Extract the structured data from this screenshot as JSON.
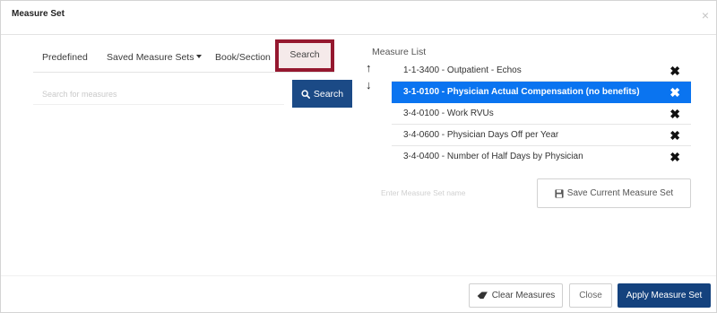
{
  "modal": {
    "title": "Measure Set",
    "close_label": "×"
  },
  "tabs": {
    "predefined": "Predefined",
    "saved_measure_sets": "Saved Measure Sets",
    "book_section": "Book/Section",
    "search": "Search"
  },
  "search": {
    "placeholder": "Search for measures",
    "value": "",
    "button_label": "Search",
    "icon": "search-icon"
  },
  "measure_list": {
    "label": "Measure List",
    "move_up_icon": "↑",
    "move_down_icon": "↓",
    "remove_icon": "✖",
    "items": [
      {
        "label": "1-1-3400 - Outpatient - Echos",
        "selected": false
      },
      {
        "label": "3-1-0100 - Physician Actual Compensation (no benefits)",
        "selected": true
      },
      {
        "label": "3-4-0100 - Work RVUs",
        "selected": false
      },
      {
        "label": "3-4-0600 - Physician Days Off per Year",
        "selected": false
      },
      {
        "label": "3-4-0400 - Number of Half Days by Physician",
        "selected": false
      }
    ]
  },
  "save_set": {
    "placeholder": "Enter Measure Set name",
    "value": "",
    "button_label": "Save Current Measure Set",
    "icon": "floppy-disk-icon"
  },
  "footer": {
    "clear_label": "Clear Measures",
    "clear_icon": "eraser-icon",
    "close_label": "Close",
    "apply_label": "Apply Measure Set"
  },
  "colors": {
    "selected_row": "#0a74f0",
    "primary_button": "#14427e",
    "search_button": "#1b4a86",
    "highlight_border": "#95182f"
  }
}
